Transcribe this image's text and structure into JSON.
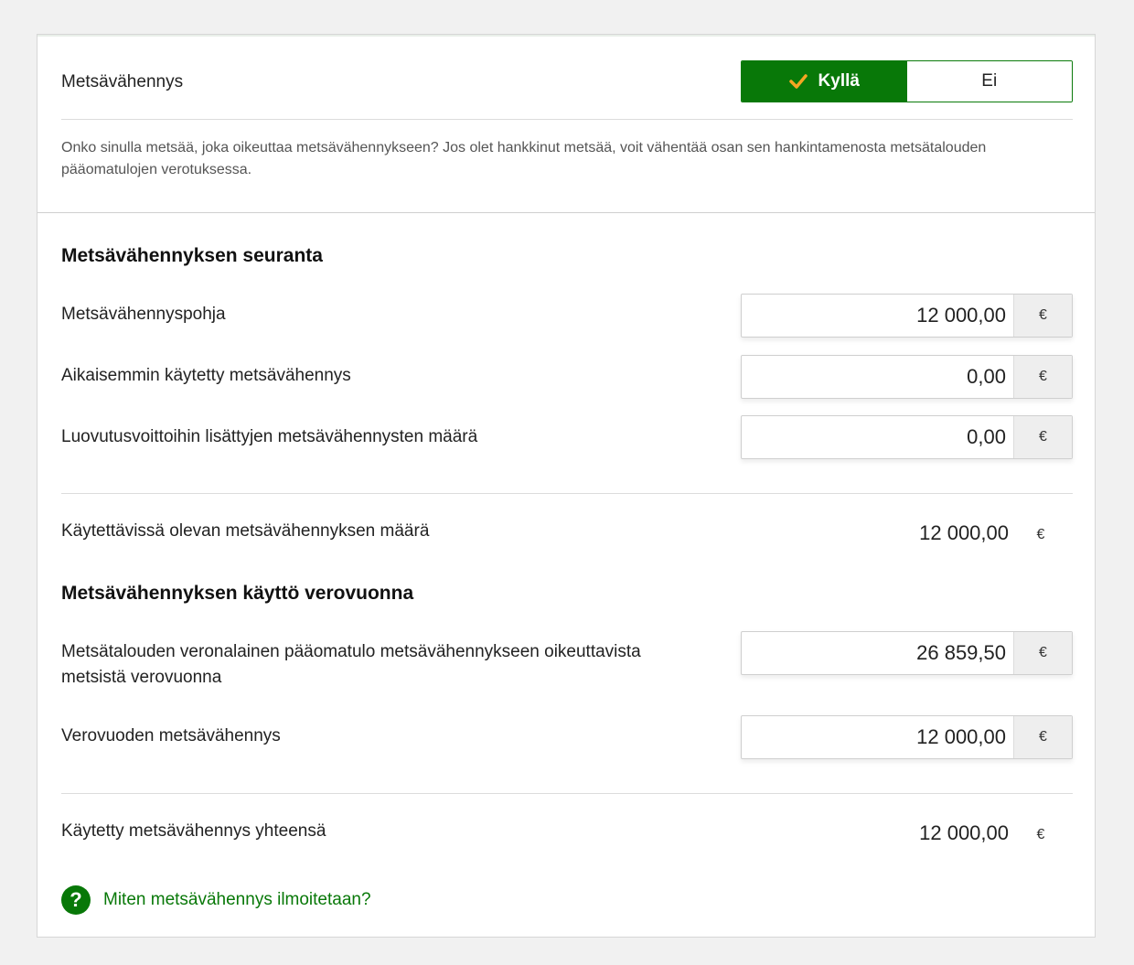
{
  "deduction_toggle": {
    "label": "Metsävähennys",
    "options": [
      "Kyllä",
      "Ei"
    ],
    "selected": "Kyllä"
  },
  "description": "Onko sinulla metsää, joka oikeuttaa metsävähennykseen? Jos olet hankkinut metsää, voit vähentää osan sen hankintamenosta metsätalouden pääomatulojen verotuksessa.",
  "tracking": {
    "title": "Metsävähennyksen seuranta",
    "rows": [
      {
        "label": "Metsävähennyspohja",
        "value": "12 000,00",
        "unit": "€"
      },
      {
        "label": "Aikaisemmin käytetty metsävähennys",
        "value": "0,00",
        "unit": "€"
      },
      {
        "label": "Luovutusvoittoihin lisättyjen metsävähennysten määrä",
        "value": "0,00",
        "unit": "€"
      }
    ],
    "available": {
      "label": "Käytettävissä olevan metsävähennyksen määrä",
      "value": "12 000,00",
      "unit": "€"
    }
  },
  "usage": {
    "title": "Metsävähennyksen käyttö verovuonna",
    "rows": [
      {
        "label": "Metsätalouden veronalainen pääomatulo metsävähennykseen oikeuttavista metsistä verovuonna",
        "value": "26 859,50",
        "unit": "€"
      },
      {
        "label": "Verovuoden metsävähennys",
        "value": "12 000,00",
        "unit": "€"
      }
    ],
    "total": {
      "label": "Käytetty metsävähennys yhteensä",
      "value": "12 000,00",
      "unit": "€"
    }
  },
  "help_link": {
    "icon": "question-circle-icon",
    "label": "Miten metsävähennys ilmoitetaan?"
  },
  "colors": {
    "accent": "#087808",
    "background": "#f1f1f1"
  }
}
